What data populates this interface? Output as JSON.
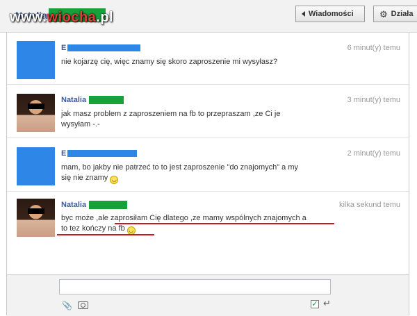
{
  "header": {
    "contact_name": "Natalia",
    "messages_button": "Wiadomości",
    "actions_button": "Działa",
    "watermark_prefix": "www.",
    "watermark_brand": "wiocha",
    "watermark_suffix": ".pl"
  },
  "messages": [
    {
      "sender": "E",
      "time": "6 minut(y) temu",
      "text": "nie kojarzę cię, więc znamy się skoro zaproszenie mi wysyłasz?"
    },
    {
      "sender": "Natalia",
      "time": "3 minut(y) temu",
      "text_line1": "jak masz problem z zaproszeniem na fb to przepraszam ,ze Ci je",
      "text_line2": "wysyłam -.-"
    },
    {
      "sender": "E",
      "time": "2 minut(y) temu",
      "text_line1": "mam, bo jakby nie patrzeć to to jest zaproszenie \"do znajomych\" a my",
      "text_line2": "się nie znamy"
    },
    {
      "sender": "Natalia",
      "time": "kilka sekund temu",
      "text_line1": "byc może ,ale zaprosiłam Cię dlatego ,ze mamy wspólnych znajomych a",
      "text_line2": "to tez kończy na fb"
    }
  ],
  "composer": {
    "reply_value": "",
    "enter_to_send_checked": true
  },
  "icons": {
    "back_arrow": "arrow-left-icon",
    "settings": "gear-icon",
    "attach": "paperclip-icon",
    "camera": "camera-icon",
    "emoticon": "smiley-icon",
    "enter": "enter-icon"
  },
  "colors": {
    "link_blue": "#3b5998",
    "redact_blue": "#2e86e6",
    "redact_green": "#16a13a",
    "annotation_red": "#d0151b"
  }
}
